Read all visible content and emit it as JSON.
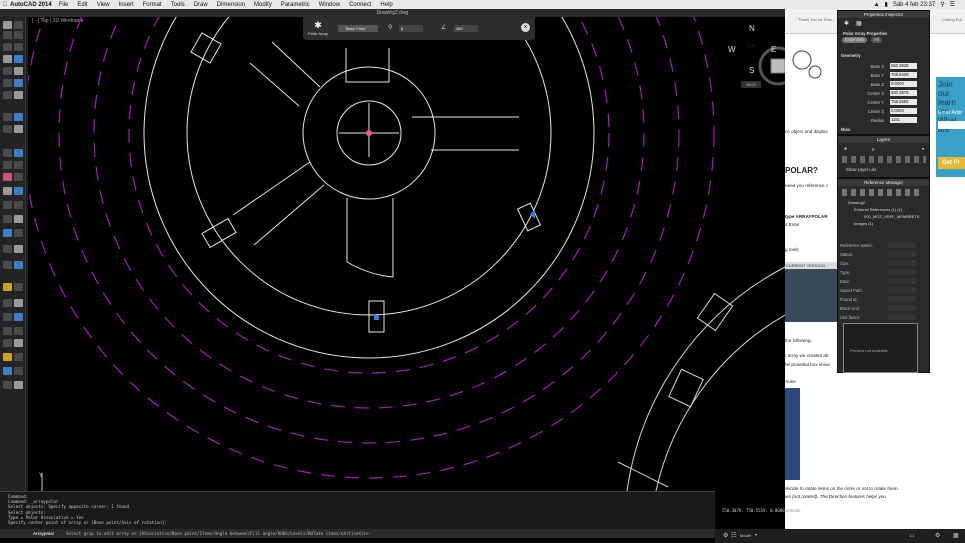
{
  "menubar": {
    "app_name": "AutoCAD 2014",
    "items": [
      "File",
      "Edit",
      "View",
      "Insert",
      "Format",
      "Tools",
      "Draw",
      "Dimension",
      "Modify",
      "Parametric",
      "Window",
      "Connect",
      "Help"
    ],
    "clock": "Sáb 4 feb 23:37"
  },
  "window": {
    "title": "Drawing2.dwg"
  },
  "viewport": {
    "label": "[ - ] Top | 2D Wireframe",
    "ucs_y": "Y"
  },
  "context_bar": {
    "polar_label": "Polar Array",
    "base_point": "Base Point",
    "items_value": "6",
    "angle_value": "360"
  },
  "viewcube": {
    "n": "N",
    "s": "S",
    "e": "E",
    "w": "W",
    "face": "TOP",
    "wcs": "WCS"
  },
  "command_line": {
    "lines": [
      "Command:",
      "Command: _arraypolar",
      "Select objects: Specify opposite corner: 1 found",
      "Select objects:",
      "Type = Polar  Associative = Yes",
      "Specify center point of array or [Base point/Axis of rotation]:"
    ],
    "prompt_label": "Arraypolar",
    "prompt_text": "Select grip to edit array or [ASsociative/Base point/Items/Angle between/Fill angle/ROWs/Levels/ROTate items/eXit]<eXit>:"
  },
  "status": {
    "coords": "550.3878, 758.5559, 0.0000",
    "model": "Model",
    "scale": "1:1"
  },
  "web": {
    "tabs": [
      "Thank You for Dow...",
      "Cutting Edi..."
    ],
    "texts": [
      "ce object and displac",
      "POLAR?",
      "need you reference c",
      "type ARRAYPOLAR",
      "it Enter",
      "g tools",
      "the following.",
      "r array we created ab",
      "he provided box show",
      "Autor",
      "decide to rotate items on the circle or not to rotate them.",
      "ies (not rotated). The Direction features helps you",
      "website"
    ],
    "thumb_label": "CURRENT VERSION",
    "join_text": "Join our learn mo What are",
    "email_label": "Email Addr",
    "get_button": "Get Fr"
  },
  "properties": {
    "title": "Properties Inspector",
    "section_title": "Polar Array Properties",
    "tabs": [
      "Essentials",
      "All"
    ],
    "geometry_label": "Geometry",
    "misc_label": "Misc",
    "fields": [
      {
        "k": "Base X",
        "v": "550.3928"
      },
      {
        "k": "Base Y",
        "v": "758.6409"
      },
      {
        "k": "Base Z",
        "v": "0.0000"
      },
      {
        "k": "Center X",
        "v": "550.3878"
      },
      {
        "k": "Center Y",
        "v": "758.5559"
      },
      {
        "k": "Center Z",
        "v": "0.0000"
      },
      {
        "k": "Radius",
        "v": "1151"
      }
    ]
  },
  "layers": {
    "title": "Layers",
    "current": "0",
    "show_list": "Show Layer List"
  },
  "reference_manager": {
    "title": "Reference Manager",
    "tree": [
      "Drawing2",
      "External References (1) (1)",
      "000_MOZ_XREF_MEMBRETE",
      "Images (1)"
    ],
    "fields": [
      "Reference Name:",
      "Status:",
      "Size:",
      "Type:",
      "Date:",
      "Saved Path:",
      "Found at:",
      "Block Unit:",
      "Unit factor:"
    ],
    "preview_text": "Preview not available"
  }
}
